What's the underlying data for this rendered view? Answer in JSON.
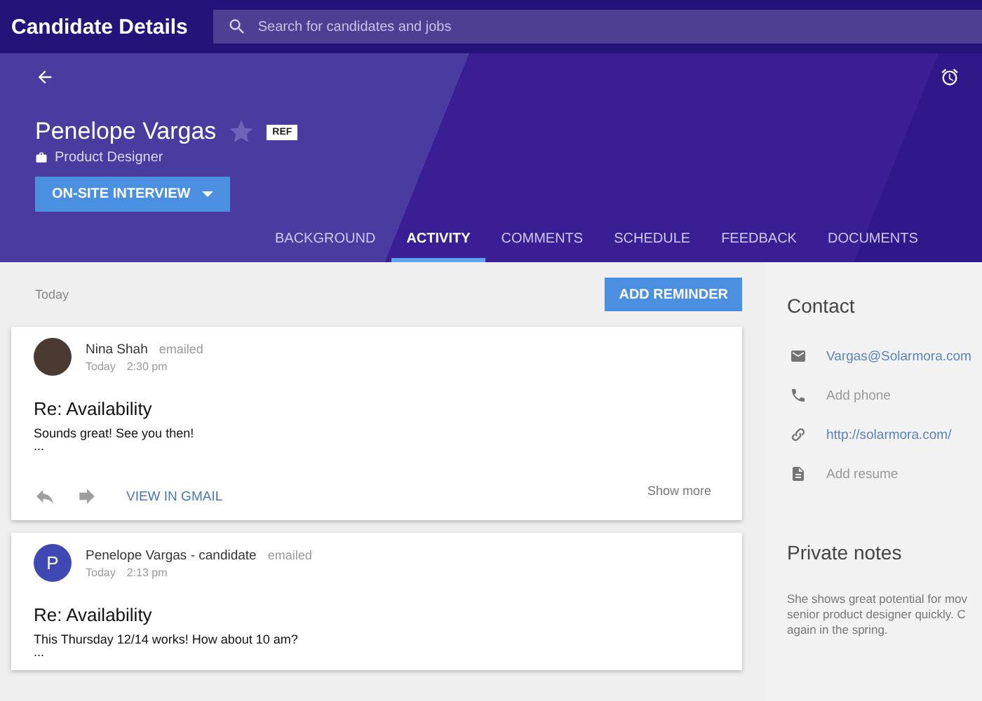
{
  "app_bar": {
    "title": "Candidate Details",
    "search": {
      "placeholder": "Search for candidates and jobs"
    }
  },
  "candidate": {
    "name": "Penelope Vargas",
    "starred": false,
    "badge": "REF",
    "role": "Product Designer",
    "stage_button": "ON-SITE INTERVIEW"
  },
  "tabs": [
    {
      "label": "BACKGROUND",
      "selected": false
    },
    {
      "label": "ACTIVITY",
      "selected": true
    },
    {
      "label": "COMMENTS",
      "selected": false
    },
    {
      "label": "SCHEDULE",
      "selected": false
    },
    {
      "label": "FEEDBACK",
      "selected": false
    },
    {
      "label": "DOCUMENTS",
      "selected": false
    }
  ],
  "activity": {
    "date_heading": "Today",
    "add_button": "ADD REMINDER",
    "items": [
      {
        "kind": "photo",
        "sender": "Nina Shah",
        "action": "emailed",
        "day": "Today",
        "time": "2:30 pm",
        "subject": "Re: Availability",
        "body": "Sounds great! See you then!",
        "ellipsis": "...",
        "link": "VIEW IN GMAIL",
        "more": "Show more"
      },
      {
        "kind": "letter",
        "initial": "P",
        "sender": "Penelope Vargas - candidate",
        "action": "emailed",
        "day": "Today",
        "time": "2:13 pm",
        "subject": "Re: Availability",
        "body": "This Thursday 12/14 works! How about 10 am?",
        "ellipsis": "..."
      }
    ]
  },
  "contact": {
    "title": "Contact",
    "rows": [
      {
        "kind": "email",
        "text": "Vargas@Solarmora.com",
        "link": true
      },
      {
        "kind": "phone",
        "text": "Add phone",
        "link": false
      },
      {
        "kind": "website",
        "text": "http://solarmora.com/",
        "link": true
      },
      {
        "kind": "resume",
        "text": "Add resume",
        "link": false
      }
    ]
  },
  "notes": {
    "title": "Private notes",
    "lines": [
      "She shows great potential for mov",
      "senior product designer quickly. C",
      "again in the spring."
    ]
  }
}
